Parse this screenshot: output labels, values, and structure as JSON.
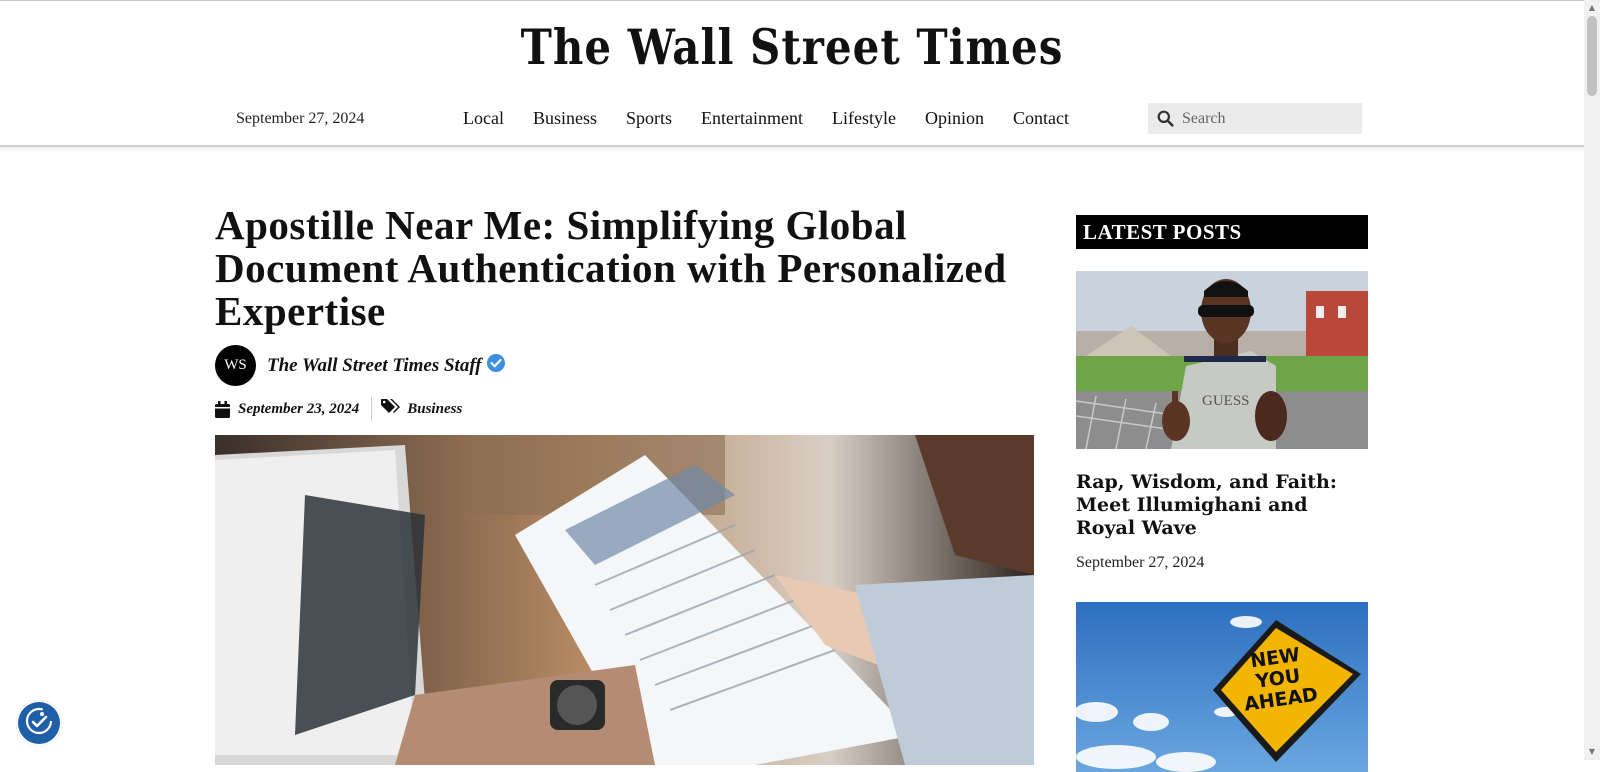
{
  "site": {
    "logo": "The Wall Street Times"
  },
  "nav": {
    "date": "September 27, 2024",
    "links": [
      "Local",
      "Business",
      "Sports",
      "Entertainment",
      "Lifestyle",
      "Opinion",
      "Contact"
    ],
    "search_placeholder": "Search"
  },
  "article": {
    "title": "Apostille Near Me: Simplifying Global Document Authentication with Personalized Expertise",
    "author": {
      "initials": "WS",
      "name": "The Wall Street Times Staff"
    },
    "date": "September 23, 2024",
    "category": "Business",
    "hero_image": "woman-reviewing-document-at-laptop-photo"
  },
  "sidebar": {
    "heading": "LATEST POSTS",
    "posts": [
      {
        "image": "man-in-sunglasses-and-guess-shirt-photo",
        "title": "Rap, Wisdom, and Faith: Meet Illumighani and Royal Wave",
        "date": "September 27, 2024"
      },
      {
        "image": "new-you-ahead-road-sign-photo",
        "image_text": "NEW YOU AHEAD"
      }
    ]
  },
  "icons": {
    "search": "search-icon",
    "calendar": "calendar-icon",
    "tags": "tags-icon",
    "verified": "verified-badge-icon",
    "accessibility": "accessibility-icon"
  },
  "colors": {
    "verified": "#3d8fe0",
    "accessibility_button": "#1e5fa8",
    "latest_head_bg": "#000000"
  }
}
